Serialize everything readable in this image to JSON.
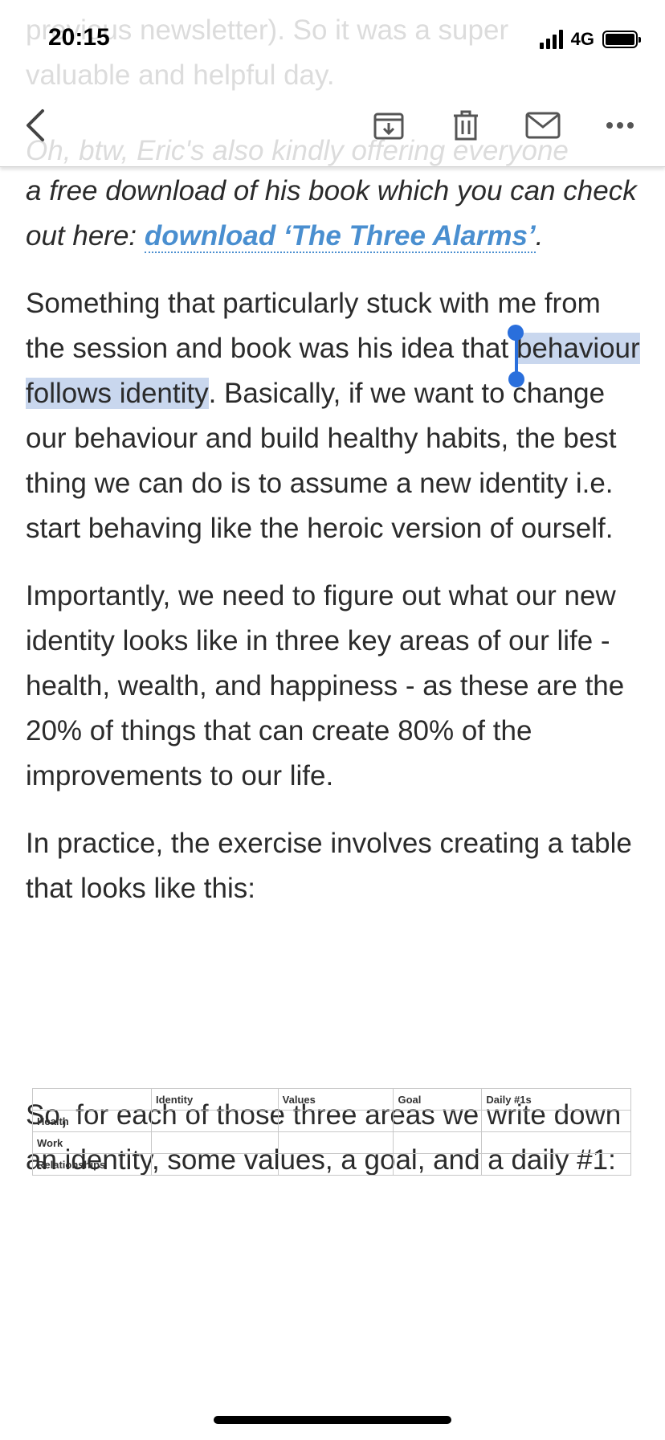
{
  "status": {
    "time": "20:15",
    "network": "4G"
  },
  "ghost_text": {
    "line1": "previous newsletter). So it was a super",
    "line2": "valuable and helpful day.",
    "line3": "Oh, btw, Eric's also kindly offering everyone"
  },
  "toolbar": {
    "back": "back-icon",
    "archive": "archive-icon",
    "delete": "trash-icon",
    "mail": "mail-icon",
    "more": "more-icon"
  },
  "article": {
    "p1_prefix": "a free download of his book which you can check out here: ",
    "p1_link": "download ‘The Three Alarms’",
    "p1_suffix": ".",
    "p2_before": "Something that particularly stuck with me from the session and book was his idea that ",
    "p2_selected": "behaviour follows identity",
    "p2_after": ". Basically, if we want to change our behaviour and build healthy habits, the best thing we can do is to assume a new identity i.e. start behaving like the heroic version of ourself.",
    "p3": "Importantly, we need to figure out what our new identity looks like in three key areas of our life - health, wealth, and happiness - as these are the 20% of things that can create 80% of the improvements to our life.",
    "p4": "In practice, the exercise involves creating a table that looks like this:",
    "p5": "So, for each of those three areas we write down an identity, some values, a goal, and a daily #1:"
  },
  "table": {
    "headers": [
      "",
      "Identity",
      "Values",
      "Goal",
      "Daily #1s"
    ],
    "rows": [
      "Health",
      "Work",
      "Relationships"
    ]
  },
  "colors": {
    "link": "#4a8fd0",
    "selection": "#c9d7ee",
    "handle": "#2a6fdc"
  }
}
